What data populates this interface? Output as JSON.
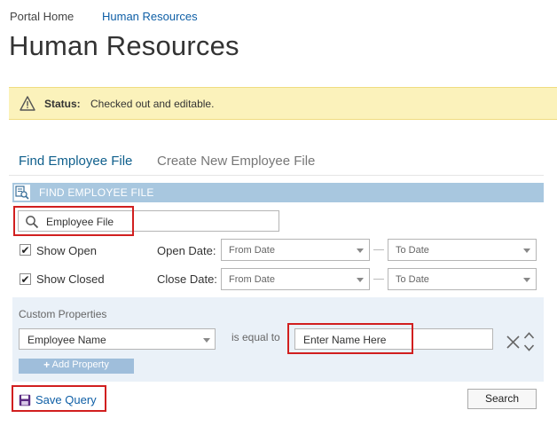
{
  "breadcrumb": {
    "home": "Portal Home",
    "current": "Human Resources"
  },
  "page_title": "Human Resources",
  "status": {
    "label": "Status:",
    "text": "Checked out and editable."
  },
  "tabs": [
    {
      "label": "Find Employee File",
      "active": true
    },
    {
      "label": "Create New Employee File",
      "active": false
    }
  ],
  "section": {
    "header": "FIND EMPLOYEE FILE"
  },
  "search": {
    "value": "Employee File"
  },
  "filters": {
    "show_open": {
      "label": "Show Open",
      "checked": true
    },
    "show_closed": {
      "label": "Show Closed",
      "checked": true
    },
    "open_date_label": "Open Date:",
    "close_date_label": "Close Date:",
    "from_placeholder": "From Date",
    "to_placeholder": "To Date"
  },
  "custom": {
    "title": "Custom Properties",
    "property": "Employee Name",
    "operator": "is equal to",
    "value": "Enter Name Here",
    "add_label": "Add Property"
  },
  "footer": {
    "save_label": "Save Query",
    "search_label": "Search"
  },
  "colors": {
    "accent": "#0f5fa6",
    "status_bg": "#fbf2bb",
    "header_bg": "#a8c7df",
    "highlight": "#d11f1f"
  }
}
